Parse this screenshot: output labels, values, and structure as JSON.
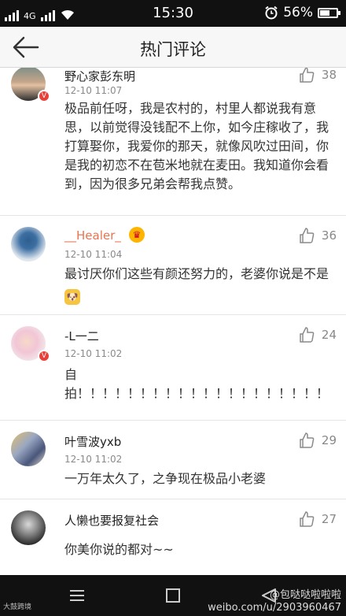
{
  "status_bar": {
    "network": "4G",
    "time": "15:30",
    "battery_percent": "56%",
    "battery_level": 0.56,
    "icons": [
      "signal-icon",
      "wifi-icon",
      "alarm-icon",
      "battery-icon"
    ]
  },
  "header": {
    "title": "热门评论",
    "back_icon": "arrow-left-icon"
  },
  "comments": [
    {
      "username": "野心家彭东明",
      "timestamp": "",
      "likes": "38",
      "text": "极品前任呀，我是农村的，村里人都说我有意思，以前觉得没钱配不上你，如今庄稼收了，我打算娶你，我爱你的那天，就像风吹过田间，你是我的初恋不在苞米地就在麦田。我知道你会看到，因为很多兄弟会帮我点赞。",
      "verified": true
    },
    {
      "username": "__Healer_",
      "timestamp": "12-10 11:04",
      "likes": "36",
      "text": "最讨厌你们这些有颜还努力的，老婆你说是不是",
      "emoji": "doge-emoji",
      "vip": true
    },
    {
      "username": "-L一二",
      "timestamp": "12-10 11:02",
      "likes": "24",
      "text_line1": "自",
      "text_line2": "拍！！！！！！！！！！！！！！！！！！！！！！",
      "verified": true
    },
    {
      "username": "叶雪波yxb",
      "timestamp": "12-10 11:02",
      "likes": "29",
      "text": "一万年太久了，之争现在极品小老婆"
    },
    {
      "username": "人懒也要报复社会",
      "timestamp": "",
      "likes": "27",
      "text": "你美你说的都对~~"
    }
  ],
  "first_comment_time_partial": "12-10 11:07",
  "watermarks": {
    "left": "大鼓跨境",
    "weibo_handle": "@包哒哒啦啦啦",
    "weibo_url": "weibo.com/u/2903960467"
  },
  "colors": {
    "accent_orange": "#eb7350",
    "badge_red": "#e8403a",
    "status_bar": "#111111"
  }
}
